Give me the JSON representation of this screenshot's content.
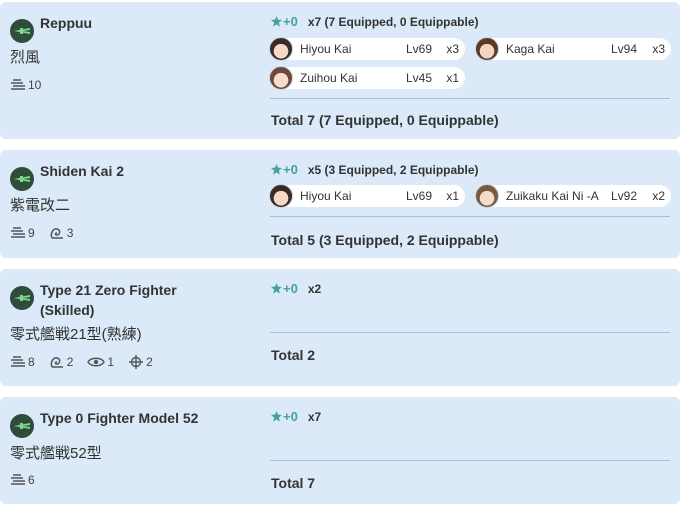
{
  "cards": [
    {
      "name": "Reppuu",
      "jname": "烈風",
      "stats": [
        {
          "icon": "airplane-stat-icon",
          "value": "10"
        }
      ],
      "improvement": "+0",
      "summary": "x7 (7 Equipped, 0 Equippable)",
      "ships": [
        {
          "name": "Hiyou Kai",
          "level": "Lv69",
          "count": "x3"
        },
        {
          "name": "Kaga Kai",
          "level": "Lv94",
          "count": "x3"
        },
        {
          "name": "Zuihou Kai",
          "level": "Lv45",
          "count": "x1"
        }
      ],
      "total": "Total 7 (7 Equipped, 0 Equippable)"
    },
    {
      "name": "Shiden Kai 2",
      "jname": "紫電改二",
      "stats": [
        {
          "icon": "airplane-stat-icon",
          "value": "9"
        },
        {
          "icon": "evasion-stat-icon",
          "value": "3"
        }
      ],
      "improvement": "+0",
      "summary": "x5 (3 Equipped, 2 Equippable)",
      "ships": [
        {
          "name": "Hiyou Kai",
          "level": "Lv69",
          "count": "x1"
        },
        {
          "name": "Zuikaku Kai Ni -A",
          "level": "Lv92",
          "count": "x2"
        }
      ],
      "total": "Total 5 (3 Equipped, 2 Equippable)"
    },
    {
      "name": "Type 21 Zero Fighter (Skilled)",
      "jname": "零式艦戦21型(熟練)",
      "stats": [
        {
          "icon": "airplane-stat-icon",
          "value": "8"
        },
        {
          "icon": "evasion-stat-icon",
          "value": "2"
        },
        {
          "icon": "eye-stat-icon",
          "value": "1"
        },
        {
          "icon": "crosshair-stat-icon",
          "value": "2"
        }
      ],
      "improvement": "+0",
      "summary": "x2",
      "ships": [],
      "total": "Total 2"
    },
    {
      "name": "Type 0 Fighter Model 52",
      "jname": "零式艦戦52型",
      "stats": [
        {
          "icon": "airplane-stat-icon",
          "value": "6"
        }
      ],
      "improvement": "+0",
      "summary": "x7",
      "ships": [],
      "total": "Total 7"
    }
  ],
  "colors": {
    "card_bg": "#dbe9f8",
    "accent_teal": "#45a29e",
    "fighter_icon": "#2f4d3a"
  }
}
